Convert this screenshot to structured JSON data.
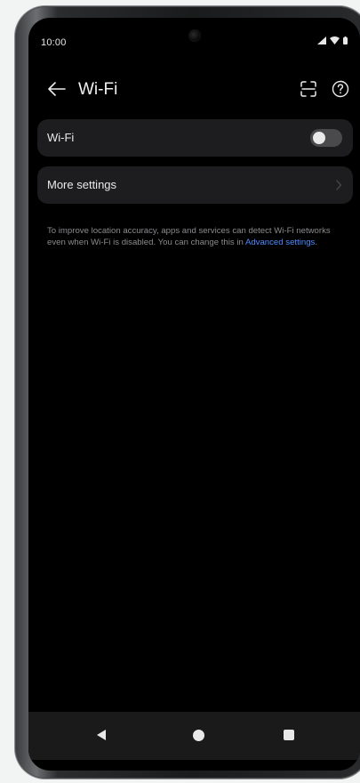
{
  "status_bar": {
    "time": "10:00"
  },
  "header": {
    "title": "Wi-Fi"
  },
  "wifi_row": {
    "label": "Wi-Fi",
    "toggle_on": false
  },
  "more_row": {
    "label": "More settings"
  },
  "info": {
    "text": "To improve location accuracy, apps and services can detect Wi-Fi networks even when Wi-Fi is disabled. You can change this in ",
    "link_text": "Advanced settings",
    "suffix": "."
  },
  "colors": {
    "background": "#000000",
    "card": "#1d1d1f",
    "link": "#4f8bff",
    "toggle_track": "#4a4a4c"
  },
  "icons": {
    "back": "arrow-left-icon",
    "scan": "qr-scan-icon",
    "help": "help-circle-icon",
    "chevron": "chevron-right-icon"
  }
}
